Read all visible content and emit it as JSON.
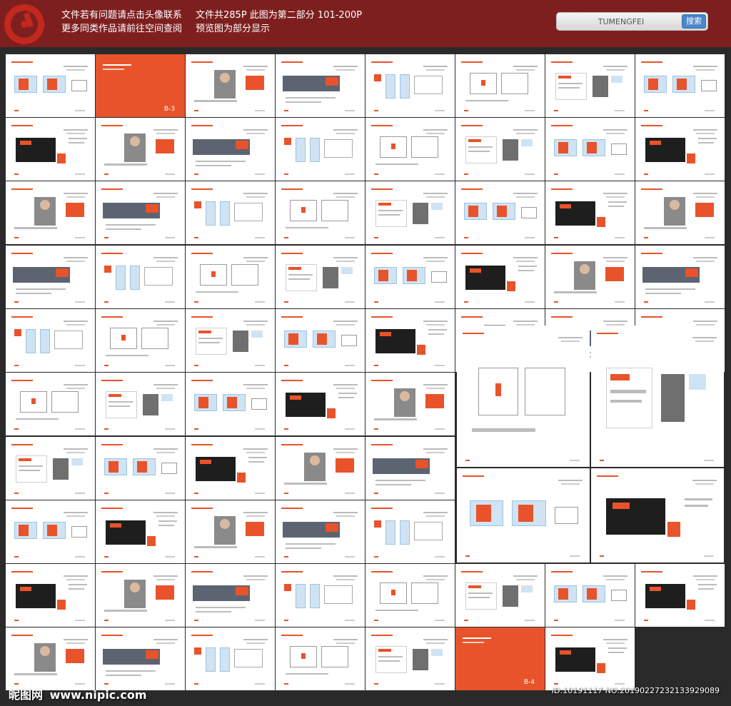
{
  "banner": {
    "line1_left": "文件若有问题请点击头像联系",
    "line2_left": "更多同类作品请前往空间查阅",
    "line1_right": "文件共285P  此图为第二部分 101-200P",
    "line2_right": "预览图为部分显示"
  },
  "search": {
    "value": "TUMENGFEI",
    "button_label": "搜索"
  },
  "sheet_labels": {
    "b3": "B-3",
    "b4": "B-4"
  },
  "watermark": {
    "logo_text": "昵图网",
    "url": "www.nipic.com"
  },
  "image_id": "ID:10191117 NO:20190227232133929089",
  "colors": {
    "banner": "#7e1f1f",
    "accent": "#e8532b",
    "brand_dark": "#1e1e1e",
    "search_button": "#4b86c9"
  }
}
